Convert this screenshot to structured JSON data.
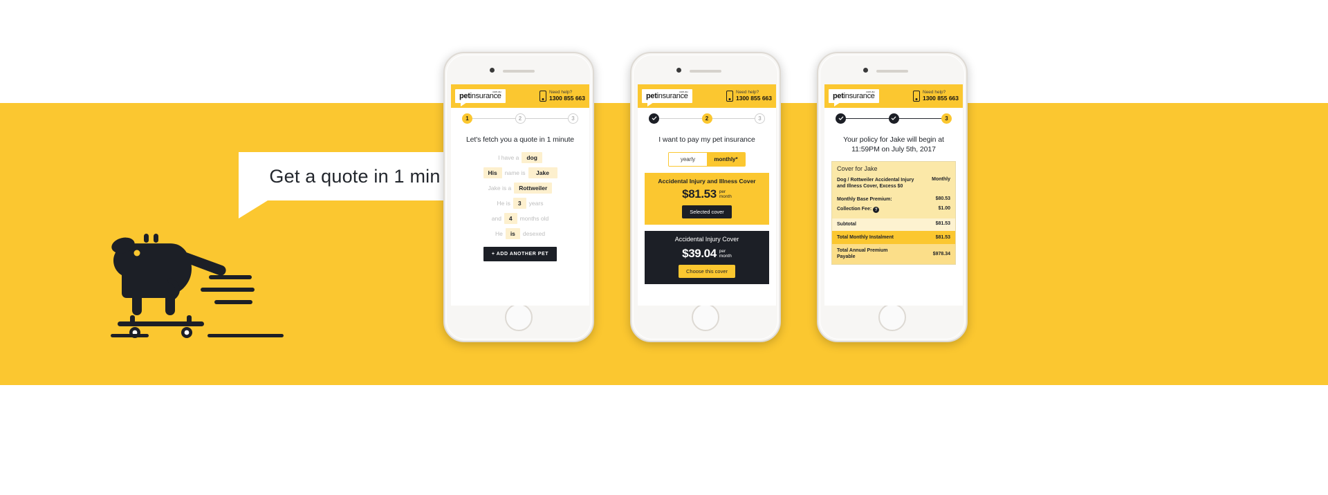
{
  "hero": {
    "headline": "Get a quote in 1 min",
    "band_color": "#FBC730"
  },
  "app_header": {
    "logo_main": "pet",
    "logo_sub": "insurance",
    "logo_tld": "com.au",
    "help_question": "Need help?",
    "help_number": "1300 855 663",
    "phone_icon": "mobile-phone-icon"
  },
  "phones": [
    {
      "id": "phone-1",
      "steps": [
        {
          "label": "1",
          "state": "active"
        },
        {
          "label": "2",
          "state": "inactive"
        },
        {
          "label": "3",
          "state": "inactive"
        }
      ],
      "title": "Let's fetch you a quote in 1 minute",
      "form_rows": [
        {
          "pre": "I have a",
          "value": "dog",
          "post": ""
        },
        {
          "pre": "",
          "lead_value": "His",
          "mid": "name is",
          "value": "Jake",
          "post": ""
        },
        {
          "pre": "Jake is a",
          "value": "Rottweiler",
          "post": ""
        },
        {
          "pre": "He is",
          "value": "3",
          "post": "years"
        },
        {
          "pre": "and",
          "value": "4",
          "post": "months old"
        },
        {
          "pre": "He",
          "value": "is",
          "post": "desexed"
        }
      ],
      "button": "+ ADD ANOTHER PET"
    },
    {
      "id": "phone-2",
      "steps": [
        {
          "label": "",
          "state": "done"
        },
        {
          "label": "2",
          "state": "active"
        },
        {
          "label": "3",
          "state": "inactive"
        }
      ],
      "title": "I want to pay my pet insurance",
      "toggle": {
        "option_left": "yearly",
        "option_right": "monthly*",
        "selected": "monthly*"
      },
      "covers": [
        {
          "name": "Accidental Injury and Illness Cover",
          "price": "$81.53",
          "period_line1": "per",
          "period_line2": "month",
          "cta": "Selected cover",
          "theme": "yellow"
        },
        {
          "name": "Accidental Injury Cover",
          "price": "$39.04",
          "period_line1": "per",
          "period_line2": "month",
          "cta": "Choose this cover",
          "theme": "dark"
        }
      ]
    },
    {
      "id": "phone-3",
      "steps": [
        {
          "label": "",
          "state": "done"
        },
        {
          "label": "",
          "state": "done"
        },
        {
          "label": "3",
          "state": "active"
        }
      ],
      "title": "Your policy for Jake will begin at 11:59PM on July 5th, 2017",
      "summary": {
        "heading": "Cover for Jake",
        "column_header": "Monthly",
        "description": "Dog / Rottweiler Accidental Injury and Illness Cover, Excess $0",
        "rows": [
          {
            "key": "Monthly Base Premium:",
            "value": "$80.53",
            "help": false
          },
          {
            "key": "Collection Fee:",
            "value": "$1.00",
            "help": true
          }
        ],
        "subtotal": {
          "key": "Subtotal",
          "value": "$81.53"
        },
        "total_monthly": {
          "key": "Total Monthly Instalment",
          "value": "$81.53"
        },
        "total_annual": {
          "key": "Total Annual Premium Payable",
          "value": "$978.34"
        },
        "help_icon": "question-mark-icon"
      }
    }
  ]
}
